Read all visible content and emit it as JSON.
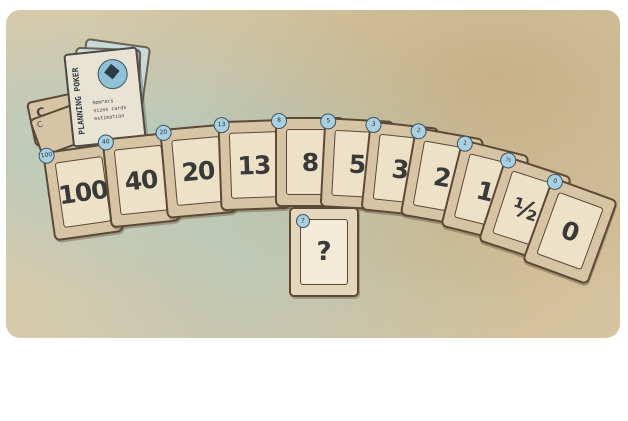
{
  "scene": {
    "deck_box": {
      "title": "PLANNING POKER",
      "caption_lines": [
        "Hom*ers",
        "sizes cards",
        "estimation"
      ],
      "icon": "diamond-icon"
    },
    "stack_corner_labels": [
      "C",
      "C"
    ],
    "cards": [
      {
        "value": "100",
        "badge": "100"
      },
      {
        "value": "40",
        "badge": "40"
      },
      {
        "value": "20",
        "badge": "20"
      },
      {
        "value": "13",
        "badge": "13"
      },
      {
        "value": "8",
        "badge": "8"
      },
      {
        "value": "5",
        "badge": "5"
      },
      {
        "value": "3",
        "badge": "3"
      },
      {
        "value": "2",
        "badge": "2"
      },
      {
        "value": "1",
        "badge": "1"
      },
      {
        "value": "½",
        "badge": "½"
      },
      {
        "value": "0",
        "badge": "0"
      }
    ],
    "unknown_card": {
      "value": "?",
      "badge": "?"
    },
    "colors": {
      "card": "#d7c4a5",
      "badge": "#a9cfe0",
      "ink": "#3a3a3a"
    }
  }
}
